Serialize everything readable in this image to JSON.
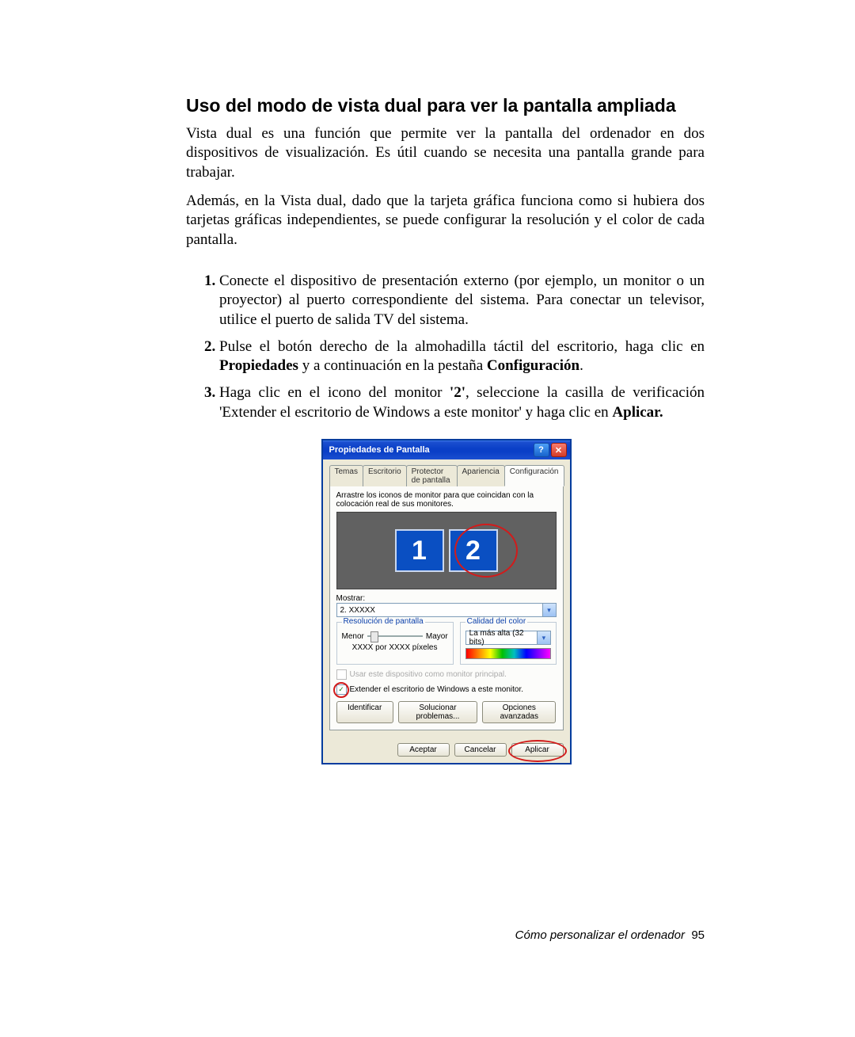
{
  "doc": {
    "title": "Uso del modo de vista dual para ver la pantalla ampliada",
    "para1": "Vista dual es una función que permite ver la pantalla del ordenador en dos dispositivos de visualización. Es útil cuando se necesita una pantalla grande para trabajar.",
    "para2": "Además, en la Vista dual, dado que la tarjeta gráfica funciona como si hubiera dos tarjetas gráficas independientes, se puede configurar la resolución y el color de cada pantalla.",
    "steps": {
      "s1": "Conecte el dispositivo de presentación externo (por ejemplo, un monitor o un proyector) al puerto correspondiente del sistema. Para conectar un televisor, utilice el puerto de salida TV del sistema.",
      "s2a": "Pulse el botón derecho de la almohadilla táctil del escritorio, haga clic en ",
      "s2b": "Propiedades",
      "s2c": " y a continuación en la pestaña ",
      "s2d": "Configuración",
      "s2e": ".",
      "s3a": "Haga clic en el icono del monitor ",
      "s3b": "'2'",
      "s3c": ", seleccione la casilla de verificación 'Extender el escritorio de Windows a este monitor' y haga clic en ",
      "s3d": "Aplicar.",
      "s3e": ""
    },
    "footer_text": "Cómo personalizar el ordenador",
    "footer_page": "95"
  },
  "dialog": {
    "title": "Propiedades de Pantalla",
    "help": "?",
    "close": "✕",
    "tabs": [
      "Temas",
      "Escritorio",
      "Protector de pantalla",
      "Apariencia",
      "Configuración"
    ],
    "active_tab_index": 4,
    "hint": "Arrastre los iconos de monitor para que coincidan con la colocación real de sus monitores.",
    "monitor1": "1",
    "monitor2": "2",
    "show_label": "Mostrar:",
    "show_value": "2. XXXXX",
    "res_group": "Resolución de pantalla",
    "res_min": "Menor",
    "res_max": "Mayor",
    "res_line": "XXXX por XXXX píxeles",
    "color_group": "Calidad del color",
    "color_value": "La más alta (32 bits)",
    "chk_primary": "Usar este dispositivo como monitor principal.",
    "chk_extend": "Extender el escritorio de Windows a este monitor.",
    "btn_identify": "Identificar",
    "btn_troubleshoot": "Solucionar problemas...",
    "btn_advanced": "Opciones avanzadas",
    "btn_ok": "Aceptar",
    "btn_cancel": "Cancelar",
    "btn_apply": "Aplicar"
  }
}
